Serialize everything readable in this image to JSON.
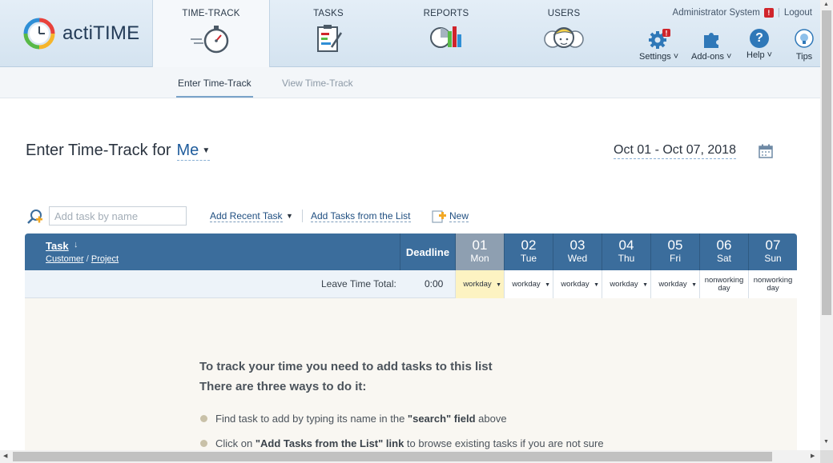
{
  "app": {
    "name": "actiTIME"
  },
  "nav": {
    "tabs": [
      {
        "label": "TIME-TRACK"
      },
      {
        "label": "TASKS"
      },
      {
        "label": "REPORTS"
      },
      {
        "label": "USERS"
      }
    ]
  },
  "user_bar": {
    "user": "Administrator System",
    "logout": "Logout"
  },
  "tools": {
    "settings": "Settings",
    "addons": "Add-ons",
    "help": "Help",
    "tips": "Tips"
  },
  "subnav": {
    "enter": "Enter Time-Track",
    "view": "View Time-Track"
  },
  "page": {
    "title": "Enter Time-Track for",
    "user_select": "Me",
    "date_range": "Oct 01 - Oct 07, 2018"
  },
  "toolbar": {
    "search_placeholder": "Add task by name",
    "add_recent": "Add Recent Task",
    "add_from_list": "Add Tasks from the List",
    "new": "New"
  },
  "table": {
    "task_header": "Task",
    "customer": "Customer",
    "slash": "/",
    "project": "Project",
    "deadline": "Deadline",
    "days": [
      {
        "num": "01",
        "name": "Mon",
        "status": "workday"
      },
      {
        "num": "02",
        "name": "Tue",
        "status": "workday"
      },
      {
        "num": "03",
        "name": "Wed",
        "status": "workday"
      },
      {
        "num": "04",
        "name": "Thu",
        "status": "workday"
      },
      {
        "num": "05",
        "name": "Fri",
        "status": "workday"
      },
      {
        "num": "06",
        "name": "Sat",
        "status": "nonworking day"
      },
      {
        "num": "07",
        "name": "Sun",
        "status": "nonworking day"
      }
    ],
    "leave_label": "Leave Time Total:",
    "leave_total": "0:00"
  },
  "empty_state": {
    "title_line1": "To track your time you need to add tasks to this list",
    "title_line2": "There are three ways to do it:",
    "hint1_pre": "Find task to add by typing its name in the ",
    "hint1_bold": "\"search\" field",
    "hint1_post": " above",
    "hint2_pre": "Click on ",
    "hint2_bold": "\"Add Tasks from the List\" link",
    "hint2_post": " to browse existing tasks if you are not sure"
  },
  "colors": {
    "header_bg": "#dbe7f2",
    "table_header": "#3b6d9c",
    "today_header": "#8e9fb1",
    "today_cell": "#fdf3c2",
    "link": "#1f4e80",
    "alert": "#d0242b"
  }
}
